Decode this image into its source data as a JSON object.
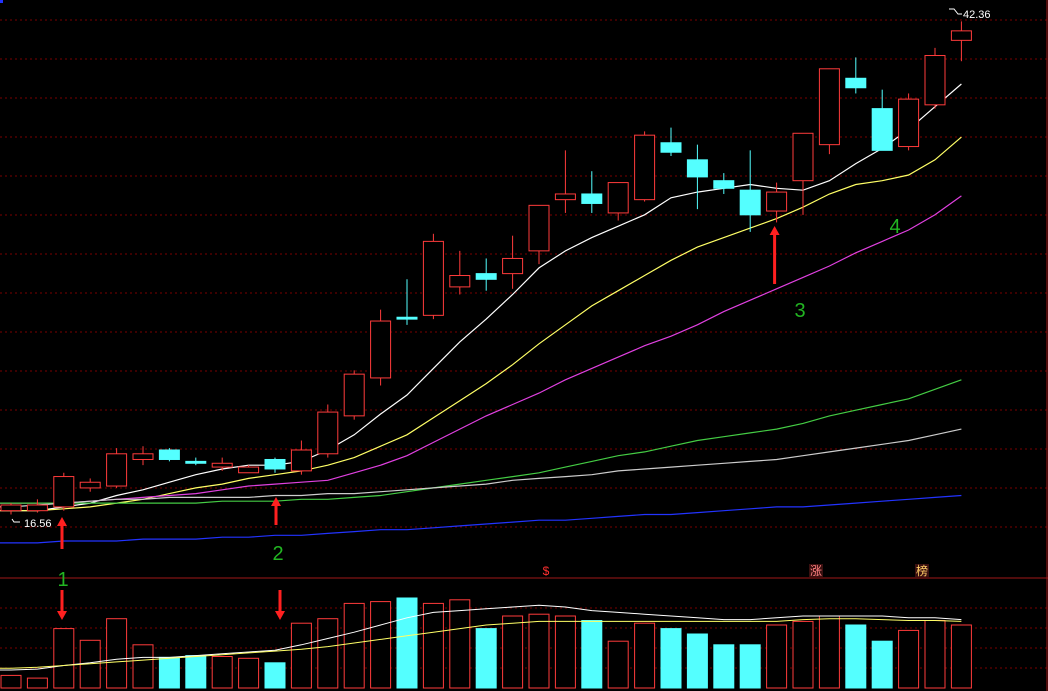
{
  "chart_data": {
    "type": "candlestick",
    "price_axis": {
      "min": 14,
      "max": 43
    },
    "volume_axis": {
      "min": 0,
      "max": 100
    },
    "max_price_label": "42.36",
    "min_price_label": "16.56",
    "candles": [
      {
        "o": 16.6,
        "h": 17.0,
        "l": 16.4,
        "c": 16.9,
        "v": 14
      },
      {
        "o": 16.6,
        "h": 17.2,
        "l": 16.5,
        "c": 16.9,
        "v": 11
      },
      {
        "o": 16.8,
        "h": 18.6,
        "l": 16.6,
        "c": 18.4,
        "v": 66
      },
      {
        "o": 17.8,
        "h": 18.3,
        "l": 17.6,
        "c": 18.1,
        "v": 53
      },
      {
        "o": 17.9,
        "h": 19.9,
        "l": 17.8,
        "c": 19.6,
        "v": 77
      },
      {
        "o": 19.3,
        "h": 20.0,
        "l": 19.0,
        "c": 19.6,
        "v": 48
      },
      {
        "o": 19.8,
        "h": 19.9,
        "l": 19.2,
        "c": 19.3,
        "v": 34
      },
      {
        "o": 19.2,
        "h": 19.4,
        "l": 19.0,
        "c": 19.1,
        "v": 36
      },
      {
        "o": 18.9,
        "h": 19.4,
        "l": 18.7,
        "c": 19.1,
        "v": 35
      },
      {
        "o": 18.6,
        "h": 19.0,
        "l": 18.6,
        "c": 18.9,
        "v": 33
      },
      {
        "o": 19.3,
        "h": 19.4,
        "l": 18.6,
        "c": 18.8,
        "v": 28
      },
      {
        "o": 18.7,
        "h": 20.3,
        "l": 18.5,
        "c": 19.8,
        "v": 72
      },
      {
        "o": 19.6,
        "h": 22.2,
        "l": 19.4,
        "c": 21.8,
        "v": 77
      },
      {
        "o": 21.6,
        "h": 24.0,
        "l": 21.4,
        "c": 23.8,
        "v": 94
      },
      {
        "o": 23.6,
        "h": 27.2,
        "l": 23.2,
        "c": 26.6,
        "v": 96
      },
      {
        "o": 26.8,
        "h": 28.8,
        "l": 26.4,
        "c": 26.7,
        "v": 100
      },
      {
        "o": 26.9,
        "h": 31.2,
        "l": 26.7,
        "c": 30.8,
        "v": 94
      },
      {
        "o": 28.4,
        "h": 30.3,
        "l": 28.0,
        "c": 29.0,
        "v": 98
      },
      {
        "o": 29.1,
        "h": 29.9,
        "l": 28.2,
        "c": 28.8,
        "v": 66
      },
      {
        "o": 29.1,
        "h": 31.1,
        "l": 28.3,
        "c": 29.9,
        "v": 80
      },
      {
        "o": 30.3,
        "h": 32.1,
        "l": 29.6,
        "c": 32.7,
        "v": 82
      },
      {
        "o": 33.0,
        "h": 35.6,
        "l": 32.3,
        "c": 33.3,
        "v": 80
      },
      {
        "o": 33.3,
        "h": 34.5,
        "l": 32.3,
        "c": 32.8,
        "v": 75
      },
      {
        "o": 32.3,
        "h": 33.9,
        "l": 31.9,
        "c": 33.9,
        "v": 52
      },
      {
        "o": 33.0,
        "h": 36.6,
        "l": 32.9,
        "c": 36.4,
        "v": 72
      },
      {
        "o": 36.0,
        "h": 36.8,
        "l": 35.3,
        "c": 35.5,
        "v": 66
      },
      {
        "o": 35.1,
        "h": 35.9,
        "l": 32.5,
        "c": 34.2,
        "v": 60
      },
      {
        "o": 34.0,
        "h": 34.4,
        "l": 33.3,
        "c": 33.6,
        "v": 48
      },
      {
        "o": 33.5,
        "h": 35.6,
        "l": 31.3,
        "c": 32.2,
        "v": 48
      },
      {
        "o": 32.4,
        "h": 33.9,
        "l": 31.8,
        "c": 33.4,
        "v": 70
      },
      {
        "o": 34.0,
        "h": 36.0,
        "l": 32.2,
        "c": 36.5,
        "v": 74
      },
      {
        "o": 35.9,
        "h": 39.6,
        "l": 35.4,
        "c": 39.9,
        "v": 80
      },
      {
        "o": 39.4,
        "h": 40.5,
        "l": 38.6,
        "c": 38.9,
        "v": 70
      },
      {
        "o": 37.8,
        "h": 38.8,
        "l": 35.6,
        "c": 35.6,
        "v": 52
      },
      {
        "o": 35.8,
        "h": 38.6,
        "l": 35.6,
        "c": 38.3,
        "v": 64
      },
      {
        "o": 38.0,
        "h": 41.0,
        "l": 37.8,
        "c": 40.6,
        "v": 75
      },
      {
        "o": 41.4,
        "h": 42.4,
        "l": 40.3,
        "c": 41.9,
        "v": 70
      }
    ],
    "ma_lines": [
      {
        "color": "#ffffff",
        "values": [
          16.6,
          16.6,
          16.8,
          17.0,
          17.4,
          17.7,
          18.1,
          18.5,
          18.8,
          19.0,
          19.0,
          19.2,
          19.8,
          20.6,
          21.7,
          22.7,
          24.1,
          25.5,
          26.7,
          28.0,
          29.4,
          30.3,
          31.0,
          31.6,
          32.2,
          33.1,
          33.4,
          33.6,
          33.8,
          33.6,
          33.5,
          34.0,
          34.9,
          35.7,
          36.7,
          37.9,
          39.1
        ]
      },
      {
        "color": "#ffff66",
        "values": [
          16.6,
          16.6,
          16.7,
          16.8,
          17.0,
          17.2,
          17.5,
          17.8,
          18.0,
          18.3,
          18.5,
          18.7,
          19.0,
          19.4,
          20.0,
          20.6,
          21.5,
          22.4,
          23.3,
          24.3,
          25.4,
          26.4,
          27.4,
          28.2,
          29.0,
          29.8,
          30.5,
          31.0,
          31.5,
          32.0,
          32.6,
          33.3,
          33.8,
          34.0,
          34.3,
          35.1,
          36.3
        ]
      },
      {
        "color": "#e040e0",
        "values": [
          17.0,
          17.0,
          17.0,
          17.1,
          17.2,
          17.3,
          17.4,
          17.5,
          17.7,
          17.9,
          18.0,
          18.1,
          18.2,
          18.6,
          19.0,
          19.5,
          20.2,
          20.9,
          21.6,
          22.2,
          22.8,
          23.5,
          24.1,
          24.7,
          25.3,
          25.8,
          26.4,
          27.1,
          27.7,
          28.3,
          28.9,
          29.5,
          30.2,
          30.8,
          31.4,
          32.2,
          33.2
        ]
      },
      {
        "color": "#44cc44",
        "values": [
          17.0,
          17.0,
          17.0,
          17.0,
          17.0,
          17.0,
          17.0,
          17.0,
          17.1,
          17.1,
          17.1,
          17.2,
          17.2,
          17.3,
          17.4,
          17.6,
          17.8,
          18.0,
          18.2,
          18.4,
          18.6,
          18.9,
          19.2,
          19.5,
          19.7,
          20.0,
          20.3,
          20.5,
          20.7,
          20.9,
          21.2,
          21.6,
          21.9,
          22.2,
          22.5,
          23.0,
          23.5
        ]
      },
      {
        "color": "#cccccc",
        "values": [
          16.8,
          16.9,
          17.0,
          17.1,
          17.2,
          17.2,
          17.3,
          17.3,
          17.3,
          17.3,
          17.4,
          17.4,
          17.5,
          17.5,
          17.6,
          17.7,
          17.8,
          17.9,
          18.0,
          18.2,
          18.3,
          18.4,
          18.5,
          18.7,
          18.8,
          18.9,
          19.0,
          19.1,
          19.2,
          19.3,
          19.5,
          19.7,
          19.9,
          20.1,
          20.3,
          20.6,
          20.9
        ]
      },
      {
        "color": "#2233ff",
        "values": [
          14.9,
          14.9,
          15.0,
          15.0,
          15.0,
          15.1,
          15.1,
          15.1,
          15.2,
          15.2,
          15.3,
          15.3,
          15.4,
          15.5,
          15.6,
          15.6,
          15.7,
          15.8,
          15.9,
          16.0,
          16.1,
          16.1,
          16.2,
          16.3,
          16.4,
          16.4,
          16.5,
          16.6,
          16.7,
          16.8,
          16.8,
          16.9,
          17.0,
          17.1,
          17.2,
          17.3,
          17.4
        ]
      }
    ],
    "volume_ma_lines": [
      {
        "color": "#ffffff",
        "values": [
          20,
          21,
          25,
          28,
          32,
          34,
          34,
          36,
          38,
          40,
          42,
          48,
          55,
          62,
          70,
          78,
          84,
          86,
          88,
          90,
          92,
          90,
          86,
          84,
          82,
          80,
          78,
          76,
          76,
          78,
          80,
          80,
          80,
          80,
          78,
          78,
          76
        ]
      },
      {
        "color": "#ffff66",
        "values": [
          22,
          23,
          25,
          27,
          29,
          31,
          33,
          35,
          37,
          39,
          41,
          43,
          46,
          50,
          54,
          58,
          62,
          66,
          70,
          72,
          74,
          74,
          74,
          74,
          74,
          74,
          74,
          74,
          74,
          74,
          76,
          77,
          77,
          76,
          75,
          75,
          74
        ]
      }
    ],
    "signals": [
      {
        "index": 2,
        "label": "1",
        "type": "price"
      },
      {
        "index": 10,
        "label": "2",
        "type": "price"
      },
      {
        "index": 29,
        "label": "3",
        "type": "price"
      },
      {
        "index": 33,
        "label": "4",
        "type": "price"
      }
    ],
    "volume_signals": [
      2,
      10
    ],
    "markers": [
      {
        "index": 20,
        "text": "$",
        "color": "#ff3030"
      },
      {
        "index": 30,
        "text": "涨",
        "color": "#ff8080"
      },
      {
        "index": 34,
        "text": "榜",
        "color": "#ffcc66"
      }
    ],
    "colors": {
      "up": "#ff3b3b",
      "down": "#54ffff",
      "grid": "#7a0000",
      "signal": "#ff2020",
      "signal_label": "#22b522"
    }
  }
}
